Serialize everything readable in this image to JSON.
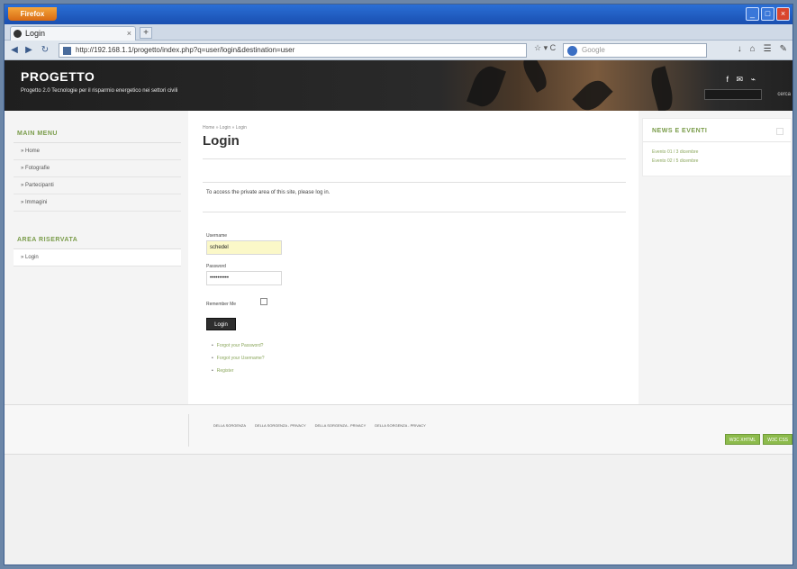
{
  "browser": {
    "app_button": "Firefox",
    "tab_title": "Login",
    "url": "http://192.168.1.1/progetto/index.php?q=user/login&destination=user",
    "search_placeholder": "Google",
    "controls": {
      "minimize": "_",
      "maximize": "□",
      "close": "×"
    }
  },
  "site": {
    "name": "PROGETTO",
    "slogan": "Progetto 2.0 Tecnologie per il risparmio energetico nei settori civili",
    "search_button": "cerca"
  },
  "sidebar": {
    "main_menu_title": "MAIN MENU",
    "main_menu": [
      "Home",
      "Fotografie",
      "Partecipanti",
      "Immagini"
    ],
    "reserved_title": "AREA RISERVATA",
    "reserved_menu": [
      "Login"
    ]
  },
  "content": {
    "breadcrumb": "Home » Login » Login",
    "title": "Login",
    "notice": "To access the private area of this site, please log in.",
    "username_label": "Username",
    "username_value": "schedel",
    "password_label": "Password",
    "password_value": "••••••••••",
    "remember_label": "Remember Me",
    "login_button": "Login",
    "links": [
      "Forgot your Password?",
      "Forgot your Username?",
      "Register"
    ]
  },
  "right_block": {
    "title": "NEWS E EVENTI",
    "links": [
      "Evento 01 / 3 dicembre",
      "Evento 02 / 5 dicembre"
    ]
  },
  "footer": {
    "links": [
      "DELLA SORGENZA",
      "DELLA SORGENZA - PRIVACY",
      "DELLA SORGENZA - PRIVACY",
      "DELLA SORGENZA - PRIVACY"
    ],
    "badges": [
      "W3C XHTML",
      "W3C CSS"
    ]
  }
}
